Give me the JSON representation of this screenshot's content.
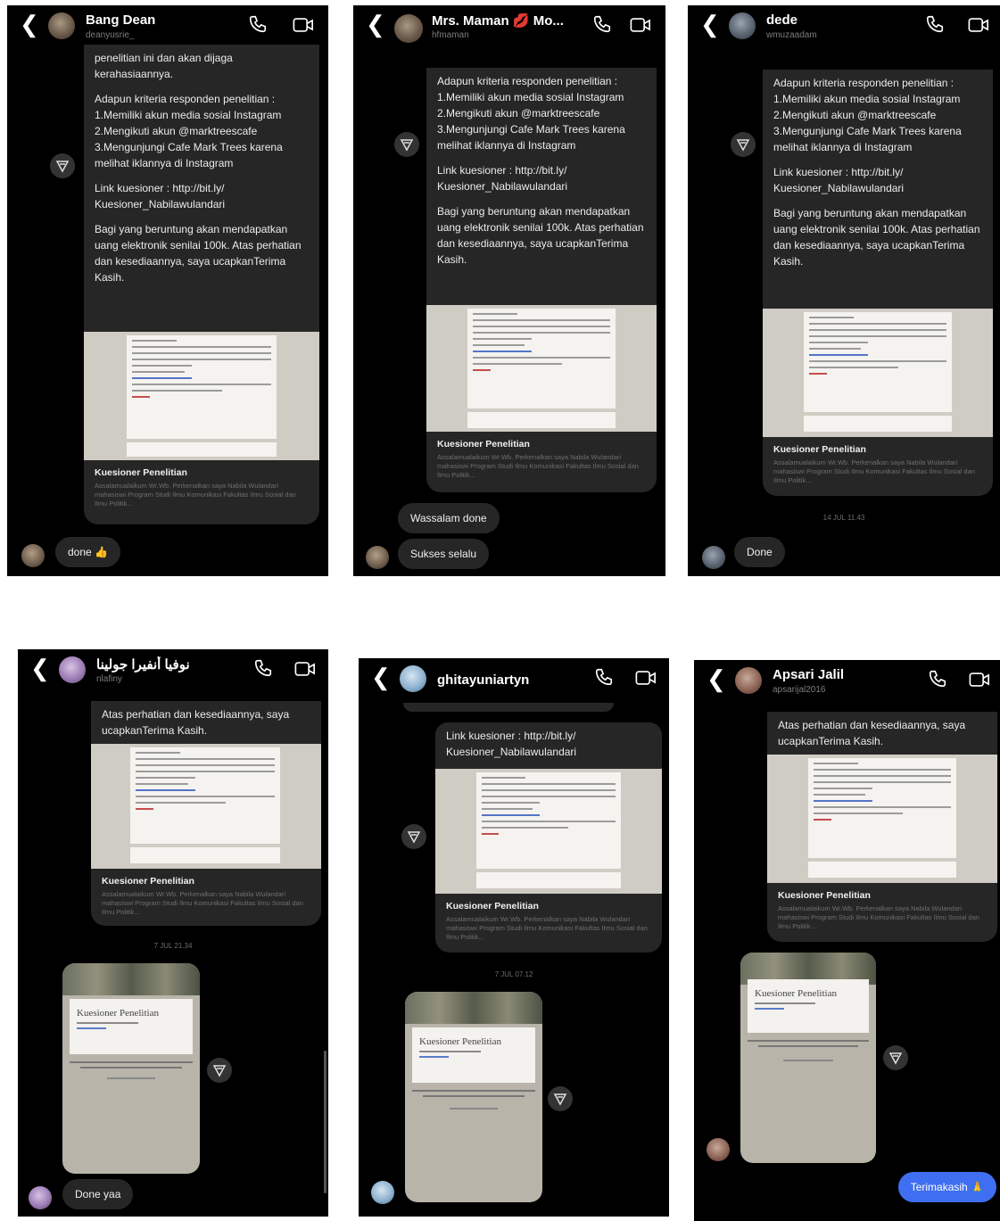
{
  "shots": [
    {
      "name": "Bang Dean",
      "username": "deanyusrie_",
      "text": [
        "penelitian ini dan akan dijaga kerahasiaannya.",
        "Adapun kriteria responden penelitian : 1.Memiliki akun media sosial Instagram 2.Mengikuti akun @marktreescafe 3.Mengunjungi Cafe Mark Trees karena melihat iklannya di Instagram",
        "Link kuesioner : http://bit.ly/ Kuesioner_Nabilawulandari",
        "Bagi yang beruntung akan mendapatkan uang elektronik senilai 100k. Atas perhatian dan kesediaannya, saya ucapkanTerima Kasih."
      ],
      "card_title": "Kuesioner Penelitian",
      "card_desc": "Assalamualaikum Wr.Wb. Perkenalkan saya Nabila Wulandari mahasiswi Program Studi Ilmu Komunikasi Fakultas Ilmu Sosial dan Ilmu Politik...",
      "reply": "done 👍"
    },
    {
      "name": "Mrs. Maman 💋 Mo...",
      "username": "hfmaman",
      "text": [
        "Adapun kriteria responden penelitian : 1.Memiliki akun media sosial Instagram 2.Mengikuti akun @marktreescafe 3.Mengunjungi Cafe Mark Trees karena melihat iklannya di Instagram",
        "Link kuesioner : http://bit.ly/ Kuesioner_Nabilawulandari",
        "Bagi yang beruntung akan mendapatkan uang elektronik senilai 100k. Atas perhatian dan kesediaannya, saya ucapkanTerima Kasih."
      ],
      "card_title": "Kuesioner Penelitian",
      "card_desc": "Assalamualaikum Wr.Wb. Perkenalkan saya Nabila Wulandari mahasiswi Program Studi Ilmu Komunikasi Fakultas Ilmu Sosial dan Ilmu Politik...",
      "replies": [
        "Wassalam done",
        "Sukses selalu"
      ]
    },
    {
      "name": "dede",
      "username": "wmuzaadam",
      "text": [
        "Adapun kriteria responden penelitian : 1.Memiliki akun media sosial Instagram 2.Mengikuti akun @marktreescafe 3.Mengunjungi Cafe Mark Trees karena melihat iklannya di Instagram",
        "Link kuesioner : http://bit.ly/ Kuesioner_Nabilawulandari",
        "Bagi yang beruntung akan mendapatkan uang elektronik senilai 100k. Atas perhatian dan kesediaannya, saya ucapkanTerima Kasih."
      ],
      "card_title": "Kuesioner Penelitian",
      "card_desc": "Assalamualaikum Wr.Wb. Perkenalkan saya Nabila Wulandari mahasiswi Program Studi Ilmu Komunikasi Fakultas Ilmu Sosial dan Ilmu Politik...",
      "timestamp": "14 JUL 11.43",
      "reply": "Done"
    },
    {
      "name": "نوفيا أنفيرا جولينا",
      "username": "nlafiny",
      "text": [
        "Atas perhatian dan kesediaannya, saya ucapkanTerima Kasih."
      ],
      "card_title": "Kuesioner Penelitian",
      "card_desc": "Assalamualaikum Wr.Wb. Perkenalkan saya Nabila Wulandari mahasiswi Program Studi Ilmu Komunikasi Fakultas Ilmu Sosial dan Ilmu Politik...",
      "timestamp": "7 JUL 21.34",
      "form_title": "Kuesioner Penelitian",
      "reply": "Done yaa"
    },
    {
      "name": "ghitayuniartyn",
      "text": [
        "Link kuesioner : http://bit.ly/ Kuesioner_Nabilawulandari"
      ],
      "card_title": "Kuesioner Penelitian",
      "card_desc": "Assalamualaikum Wr.Wb. Perkenalkan saya Nabila Wulandari mahasiswi Program Studi Ilmu Komunikasi Fakultas Ilmu Sosial dan Ilmu Politik...",
      "timestamp": "7 JUL 07.12",
      "form_title": "Kuesioner Penelitian"
    },
    {
      "name": "Apsari Jalil",
      "username": "apsarijal2016",
      "text": [
        "Atas perhatian dan kesediaannya, saya ucapkanTerima Kasih."
      ],
      "card_title": "Kuesioner Penelitian",
      "card_desc": "Assalamualaikum Wr.Wb. Perkenalkan saya Nabila Wulandari mahasiswi Program Studi Ilmu Komunikasi Fakultas Ilmu Sosial dan Ilmu Politik...",
      "form_title": "Kuesioner Penelitian",
      "sent": "Terimakasih 🙏"
    }
  ],
  "icons": [
    "back-chevron-icon",
    "phone-icon",
    "video-icon",
    "share-icon"
  ],
  "colors": {
    "background": "#000000",
    "bubble": "#262626",
    "sent_bubble": "#3f6ff0"
  }
}
